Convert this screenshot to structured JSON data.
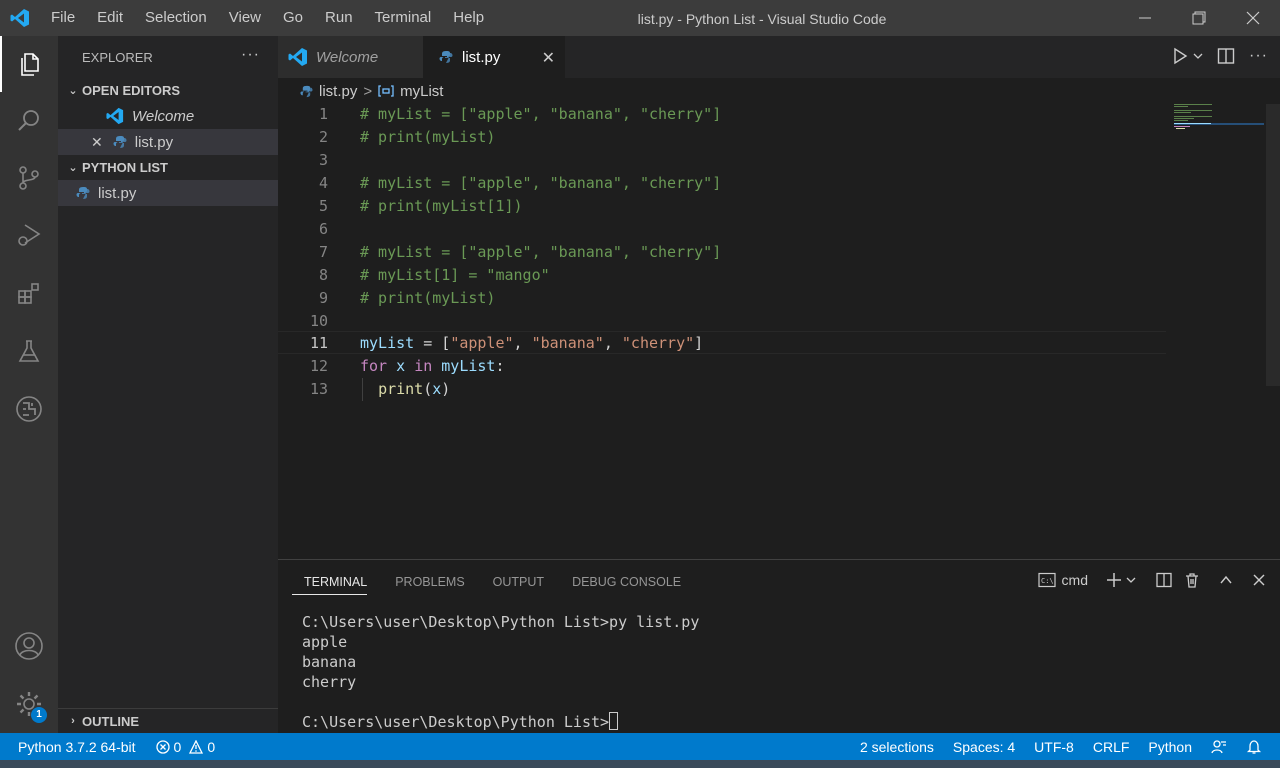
{
  "window": {
    "title": "list.py - Python List - Visual Studio Code",
    "menu": [
      "File",
      "Edit",
      "Selection",
      "View",
      "Go",
      "Run",
      "Terminal",
      "Help"
    ]
  },
  "activity_bar": {
    "icons": [
      "explorer-icon",
      "search-icon",
      "source-control-icon",
      "run-debug-icon",
      "extensions-icon",
      "testing-icon",
      "remote-icon",
      "account-icon",
      "settings-gear-icon"
    ],
    "settings_badge": "1"
  },
  "sidebar": {
    "title": "EXPLORER",
    "more": "···",
    "open_editors": {
      "label": "OPEN EDITORS",
      "items": [
        "Welcome",
        "list.py"
      ]
    },
    "project": {
      "label": "PYTHON LIST",
      "files": [
        "list.py"
      ]
    },
    "outline_label": "OUTLINE"
  },
  "tabs": [
    {
      "label": "Welcome"
    },
    {
      "label": "list.py",
      "close": "✕"
    }
  ],
  "breadcrumb": {
    "file": "list.py",
    "separator": ">",
    "symbol": "myList"
  },
  "editor": {
    "current_line": 11,
    "lines": [
      {
        "n": "1",
        "text": "# myList = [\"apple\", \"banana\", \"cherry\"]"
      },
      {
        "n": "2",
        "text": "# print(myList)"
      },
      {
        "n": "3",
        "text": ""
      },
      {
        "n": "4",
        "text": "# myList = [\"apple\", \"banana\", \"cherry\"]"
      },
      {
        "n": "5",
        "text": "# print(myList[1])"
      },
      {
        "n": "6",
        "text": ""
      },
      {
        "n": "7",
        "text": "# myList = [\"apple\", \"banana\", \"cherry\"]"
      },
      {
        "n": "8",
        "text": "# myList[1] = \"mango\""
      },
      {
        "n": "9",
        "text": "# print(myList)"
      },
      {
        "n": "10",
        "text": ""
      },
      {
        "n": "11",
        "text": "myList = [\"apple\", \"banana\", \"cherry\"]"
      },
      {
        "n": "12",
        "text": "for x in myList:"
      },
      {
        "n": "13",
        "text": "  print(x)"
      }
    ]
  },
  "panel": {
    "tabs": [
      "TERMINAL",
      "PROBLEMS",
      "OUTPUT",
      "DEBUG CONSOLE"
    ],
    "active_tab": "TERMINAL",
    "shell": "cmd",
    "terminal_lines": [
      "C:\\Users\\user\\Desktop\\Python List>py list.py",
      "apple",
      "banana",
      "cherry",
      "",
      "C:\\Users\\user\\Desktop\\Python List>"
    ]
  },
  "status_bar": {
    "interpreter": "Python 3.7.2 64-bit",
    "errors": "0",
    "warnings": "0",
    "selections": "2 selections",
    "spaces": "Spaces: 4",
    "encoding": "UTF-8",
    "eol": "CRLF",
    "language": "Python"
  },
  "colors": {
    "accent": "#007acc",
    "comment": "#6a9955",
    "string": "#ce9178",
    "variable": "#9cdcfe",
    "keyword": "#c586c0",
    "function": "#dcdcaa"
  }
}
